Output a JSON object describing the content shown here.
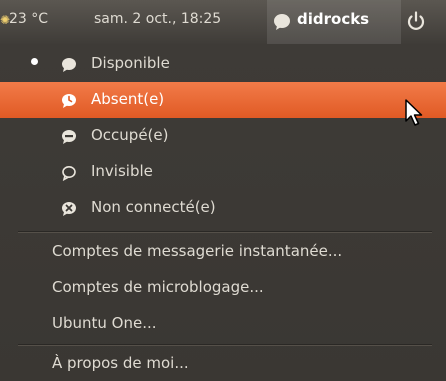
{
  "panel": {
    "weather_icon": "sun-icon",
    "weather": "23 °C",
    "clock": "sam. 2 oct., 18:25",
    "chat_icon": "chat-status-icon",
    "user": "didrocks",
    "power_icon": "power-icon"
  },
  "menu": {
    "statuses": [
      {
        "label": "Disponible",
        "icon": "available-icon",
        "selected": true
      },
      {
        "label": "Absent(e)",
        "icon": "away-icon",
        "highlighted": true
      },
      {
        "label": "Occupé(e)",
        "icon": "busy-icon"
      },
      {
        "label": "Invisible",
        "icon": "invisible-icon"
      },
      {
        "label": "Non connecté(e)",
        "icon": "offline-icon"
      }
    ],
    "accounts": [
      {
        "label": "Comptes de messagerie instantanée..."
      },
      {
        "label": "Comptes de microblogage..."
      },
      {
        "label": "Ubuntu One..."
      }
    ],
    "about": {
      "label": "À propos de moi..."
    }
  },
  "colors": {
    "highlight": "#e8663a",
    "panel": "#4a4641",
    "menu": "#3c3935"
  }
}
